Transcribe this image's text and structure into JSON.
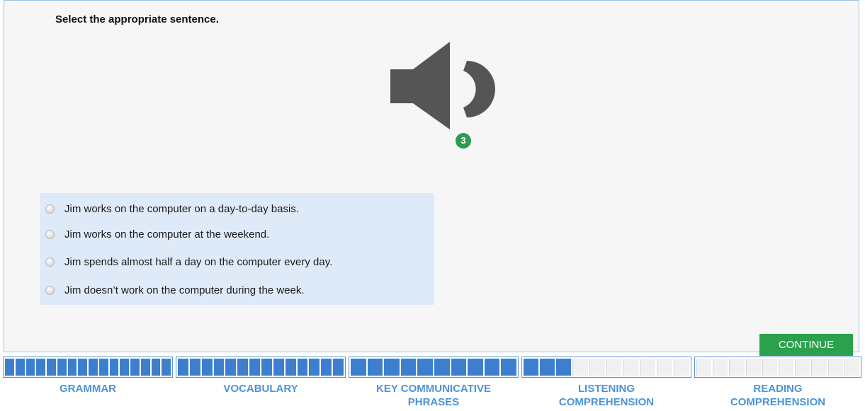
{
  "instruction": "Select the appropriate sentence.",
  "audio": {
    "icon": "speaker-icon",
    "plays_remaining": "3",
    "plays_badge_color": "#2f9a52"
  },
  "options": [
    {
      "text": "Jim works on the computer on a day-to-day basis."
    },
    {
      "text": "Jim works on the computer at the weekend."
    },
    {
      "text": "Jim spends almost half a day on the computer every day."
    },
    {
      "text": "Jim doesn’t work on the computer during the week."
    }
  ],
  "continue_label": "CONTINUE",
  "sections": [
    {
      "label_line1": "GRAMMAR",
      "label_line2": "",
      "segments_total": 16,
      "segments_filled": 16
    },
    {
      "label_line1": "VOCABULARY",
      "label_line2": "",
      "segments_total": 14,
      "segments_filled": 14
    },
    {
      "label_line1": "KEY COMMUNICATIVE",
      "label_line2": "PHRASES",
      "segments_total": 10,
      "segments_filled": 10
    },
    {
      "label_line1": "LISTENING",
      "label_line2": "COMPREHENSION",
      "segments_total": 10,
      "segments_filled": 3
    },
    {
      "label_line1": "READING",
      "label_line2": "COMPREHENSION",
      "segments_total": 10,
      "segments_filled": 0
    }
  ],
  "colors": {
    "accent": "#3d7fcf",
    "continue": "#2ba14c",
    "label": "#4a94d8",
    "options_bg": "#dfeaf8"
  }
}
